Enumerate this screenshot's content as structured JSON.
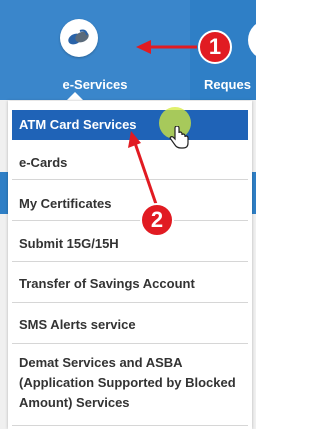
{
  "tabs": [
    {
      "label": "e-Services",
      "icon": "e-services-icon",
      "active": true
    },
    {
      "label": "Reques",
      "icon": "circle-icon",
      "active": false
    }
  ],
  "menu": {
    "items": [
      {
        "label": "ATM Card Services",
        "active": true
      },
      {
        "label": "e-Cards",
        "active": false
      },
      {
        "label": "My Certificates",
        "active": false
      },
      {
        "label": "Submit 15G/15H",
        "active": false
      },
      {
        "label": "Transfer of Savings Account",
        "active": false
      },
      {
        "label": "SMS Alerts service",
        "active": false
      },
      {
        "label": "Demat Services and ASBA (Application Supported by Blocked Amount) Services",
        "active": false
      }
    ]
  },
  "annotations": [
    {
      "label": "1",
      "points_to": "e-Services"
    },
    {
      "label": "2",
      "points_to": "ATM Card Services"
    }
  ],
  "colors": {
    "header_blue": "#2f7fc6",
    "active_item": "#1f63b7",
    "callout_red": "#e11b22",
    "cursor_highlight": "#d6eb3c"
  }
}
